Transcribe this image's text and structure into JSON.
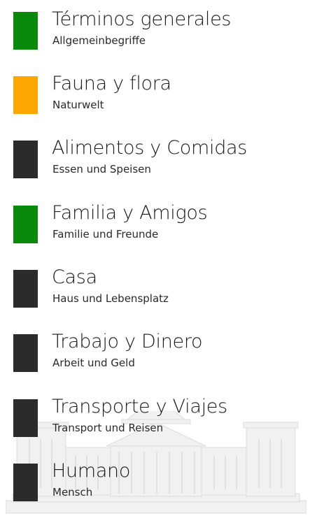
{
  "colors": {
    "green": "#0a8a0a",
    "orange": "#fda600",
    "dark": "#2b2b2b"
  },
  "categories": [
    {
      "title": "Términos generales",
      "subtitle": "Allgemeinbegriffe",
      "tile_color": "#0a8a0a"
    },
    {
      "title": "Fauna y flora",
      "subtitle": "Naturwelt",
      "tile_color": "#fda600"
    },
    {
      "title": "Alimentos y Comidas",
      "subtitle": "Essen und Speisen",
      "tile_color": "#2b2b2b"
    },
    {
      "title": "Familia y Amigos",
      "subtitle": "Familie und Freunde",
      "tile_color": "#0a8a0a"
    },
    {
      "title": "Casa",
      "subtitle": "Haus und Lebensplatz",
      "tile_color": "#2b2b2b"
    },
    {
      "title": "Trabajo y Dinero",
      "subtitle": "Arbeit und Geld",
      "tile_color": "#2b2b2b"
    },
    {
      "title": "Transporte y Viajes",
      "subtitle": "Transport und Reisen",
      "tile_color": "#2b2b2b"
    },
    {
      "title": "Humano",
      "subtitle": "Mensch",
      "tile_color": "#2b2b2b"
    }
  ],
  "background_image": "reichstag-building-illustration"
}
